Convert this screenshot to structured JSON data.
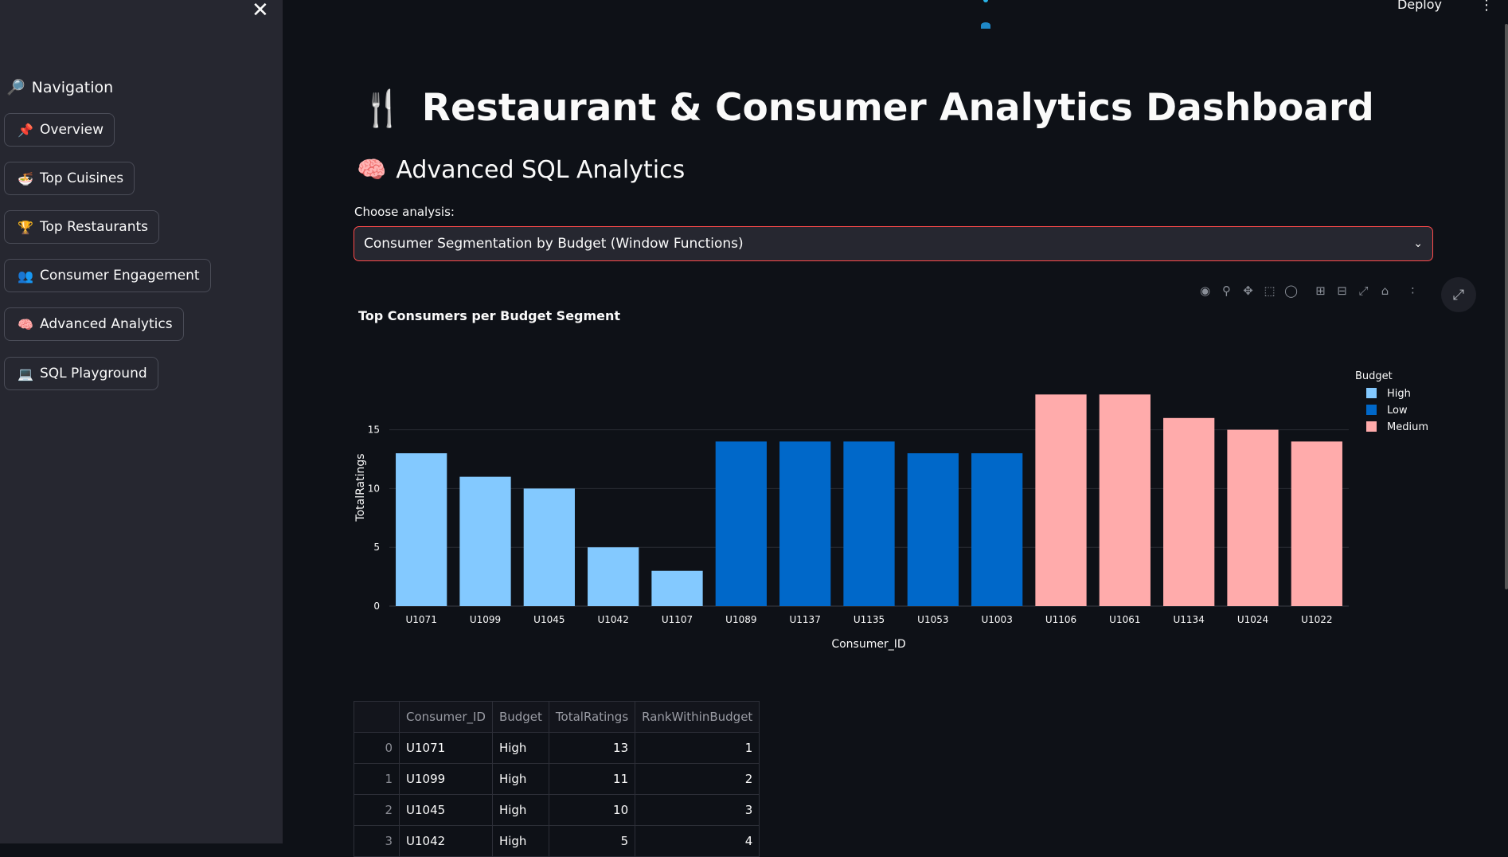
{
  "sidebar": {
    "close_icon": "✕",
    "nav_title": "Navigation",
    "nav_icon": "🔎",
    "items": [
      {
        "icon": "📌",
        "label": "Overview"
      },
      {
        "icon": "🍜",
        "label": "Top Cuisines"
      },
      {
        "icon": "🏆",
        "label": "Top Restaurants"
      },
      {
        "icon": "👥",
        "label": "Consumer Engagement"
      },
      {
        "icon": "🧠",
        "label": "Advanced Analytics"
      },
      {
        "icon": "💻",
        "label": "SQL Playground"
      }
    ]
  },
  "header": {
    "deploy_label": "Deploy",
    "menu_icon": "⋮"
  },
  "main": {
    "title_icon": "🍴",
    "title": "Restaurant & Consumer Analytics Dashboard",
    "subtitle_icon": "🧠",
    "subtitle": "Advanced SQL Analytics",
    "select_label": "Choose analysis:",
    "select_value": "Consumer Segmentation by Budget (Window Functions)"
  },
  "modebar_icons": [
    "camera-icon",
    "zoom-icon",
    "pan-icon",
    "box-select-icon",
    "lasso-icon",
    "zoom-in-icon",
    "zoom-out-icon",
    "autoscale-icon",
    "reset-axes-icon",
    "plotly-logo-icon"
  ],
  "colors": {
    "High": "#83c9ff",
    "Low": "#0068c9",
    "Medium": "#ffabab",
    "accent": "#ff4b4b"
  },
  "chart_data": {
    "type": "bar",
    "title": "Top Consumers per Budget Segment",
    "xlabel": "Consumer_ID",
    "ylabel": "TotalRatings",
    "ylim": [
      0,
      18.9
    ],
    "yticks": [
      0,
      5,
      10,
      15
    ],
    "legend_title": "Budget",
    "legend_position": "right",
    "grid": true,
    "series": [
      {
        "name": "High",
        "categories": [
          "U1071",
          "U1099",
          "U1045",
          "U1042",
          "U1107"
        ],
        "values": [
          13,
          11,
          10,
          5,
          3
        ]
      },
      {
        "name": "Low",
        "categories": [
          "U1089",
          "U1137",
          "U1135",
          "U1053",
          "U1003"
        ],
        "values": [
          14,
          14,
          14,
          13,
          13
        ]
      },
      {
        "name": "Medium",
        "categories": [
          "U1106",
          "U1061",
          "U1134",
          "U1024",
          "U1022"
        ],
        "values": [
          18,
          18,
          16,
          15,
          14
        ]
      }
    ]
  },
  "table": {
    "columns": [
      "",
      "Consumer_ID",
      "Budget",
      "TotalRatings",
      "RankWithinBudget"
    ],
    "rows": [
      [
        "0",
        "U1071",
        "High",
        "13",
        "1"
      ],
      [
        "1",
        "U1099",
        "High",
        "11",
        "2"
      ],
      [
        "2",
        "U1045",
        "High",
        "10",
        "3"
      ],
      [
        "3",
        "U1042",
        "High",
        "5",
        "4"
      ]
    ]
  }
}
